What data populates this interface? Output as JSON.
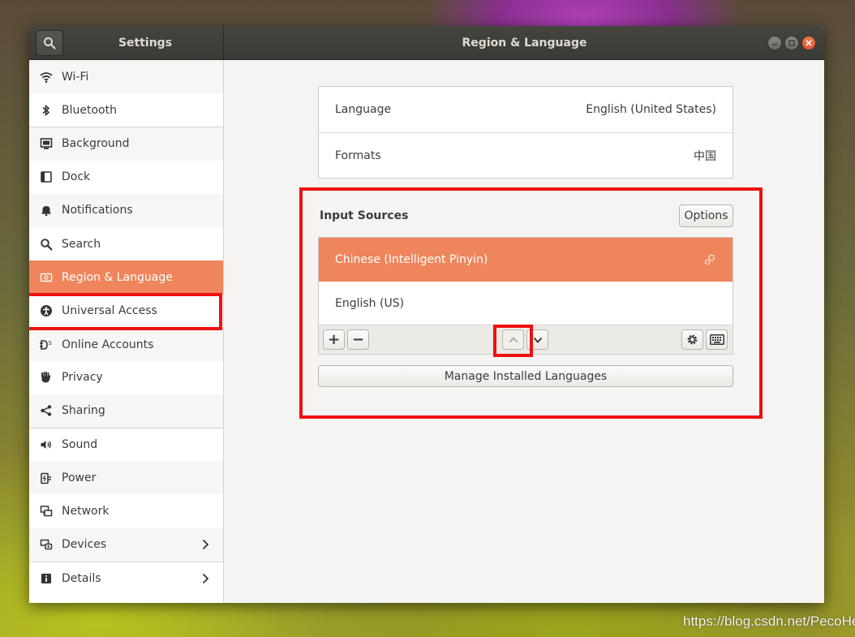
{
  "titlebar": {
    "app_title": "Settings",
    "panel_title": "Region & Language",
    "search_icon": "search-icon",
    "window_buttons": [
      "minimize",
      "maximize",
      "close"
    ]
  },
  "sidebar": {
    "items": [
      {
        "label": "Wi-Fi",
        "icon": "wifi-icon"
      },
      {
        "label": "Bluetooth",
        "icon": "bluetooth-icon"
      },
      {
        "label": "Background",
        "icon": "background-icon"
      },
      {
        "label": "Dock",
        "icon": "dock-icon"
      },
      {
        "label": "Notifications",
        "icon": "bell-icon"
      },
      {
        "label": "Search",
        "icon": "search-icon"
      },
      {
        "label": "Region & Language",
        "icon": "region-icon",
        "active": true
      },
      {
        "label": "Universal Access",
        "icon": "accessibility-icon"
      },
      {
        "label": "Online Accounts",
        "icon": "online-accounts-icon"
      },
      {
        "label": "Privacy",
        "icon": "hand-icon"
      },
      {
        "label": "Sharing",
        "icon": "share-icon"
      },
      {
        "label": "Sound",
        "icon": "speaker-icon"
      },
      {
        "label": "Power",
        "icon": "power-icon"
      },
      {
        "label": "Network",
        "icon": "network-icon"
      },
      {
        "label": "Devices",
        "icon": "devices-icon",
        "has_submenu": true
      },
      {
        "label": "Details",
        "icon": "info-icon",
        "has_submenu": true
      }
    ]
  },
  "region": {
    "language_label": "Language",
    "language_value": "English (United States)",
    "formats_label": "Formats",
    "formats_value": "中国"
  },
  "input_sources": {
    "title": "Input Sources",
    "options_label": "Options",
    "sources": [
      {
        "label": "Chinese (Intelligent Pinyin)",
        "selected": true,
        "icon": "settings-gears-icon"
      },
      {
        "label": "English (US)",
        "selected": false
      }
    ],
    "toolbar": {
      "add_label": "+",
      "remove_label": "−",
      "move_up_icon": "chevron-up-icon",
      "move_down_icon": "chevron-down-icon",
      "settings_icon": "gear-icon",
      "keyboard_icon": "keyboard-icon"
    },
    "manage_label": "Manage Installed Languages"
  },
  "watermark": "https://blog.csdn.net/PecoHe",
  "colors": {
    "accent": "#ef855c",
    "highlight": "#ee1111",
    "titlebar": "#3b3a36"
  }
}
